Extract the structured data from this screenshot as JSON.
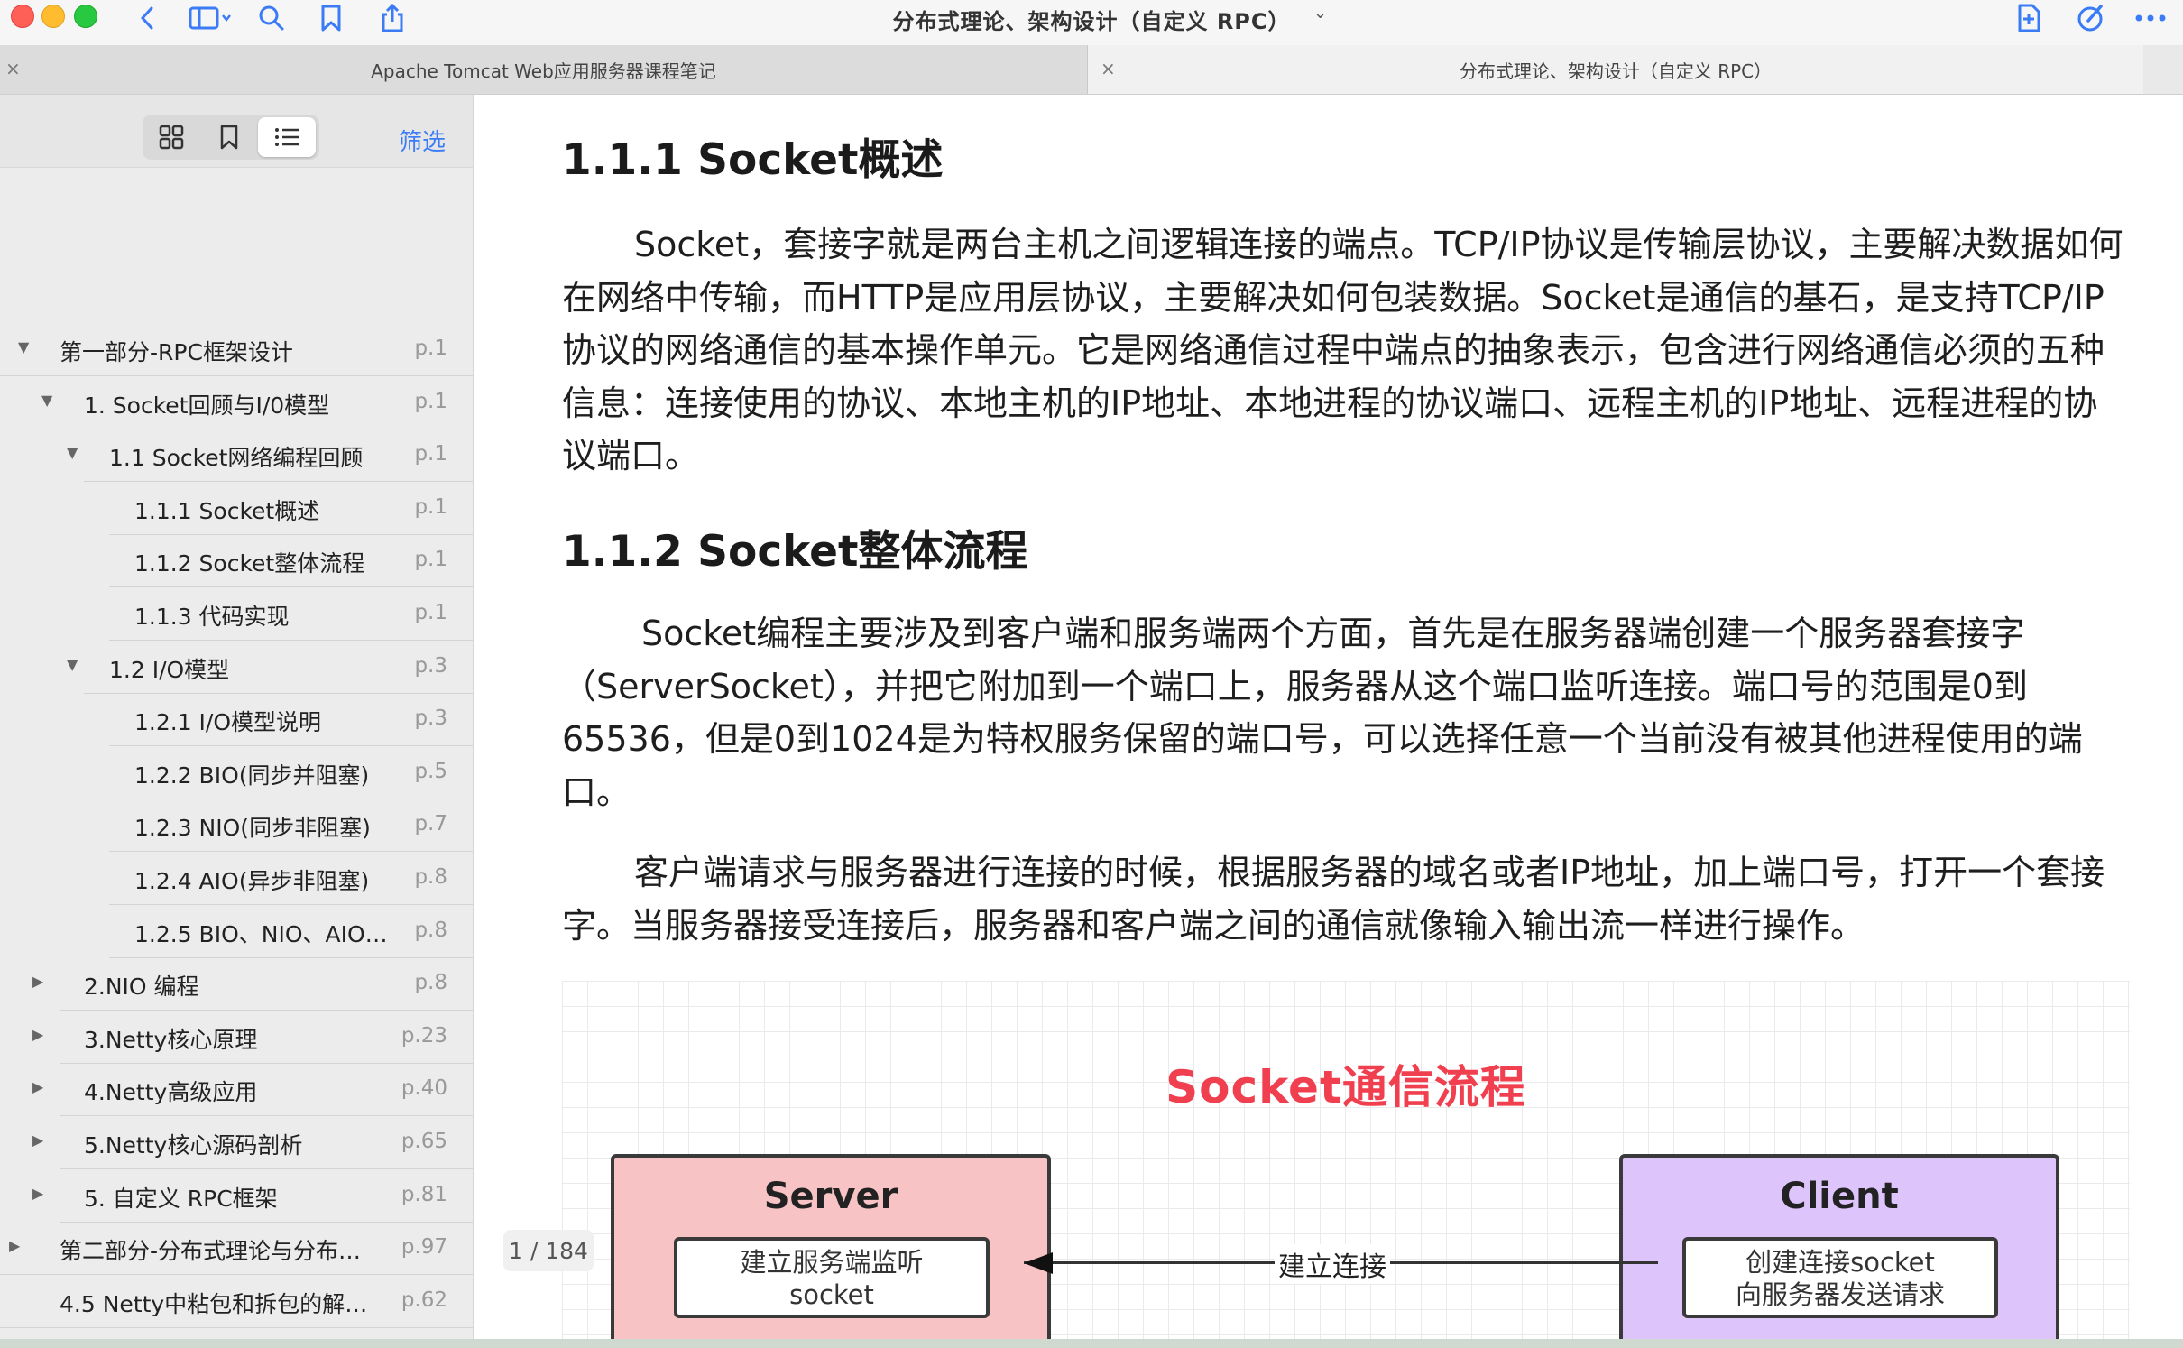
{
  "window": {
    "title": "分布式理论、架构设计（自定义 RPC）",
    "title_chevron": "⌄"
  },
  "toolbar": {
    "icons": [
      "back-icon",
      "sidebar-icon",
      "search-icon",
      "bookmark-icon",
      "share-icon",
      "add-page-icon",
      "markup-icon",
      "more-icon"
    ]
  },
  "tabs": [
    {
      "label": "Apache Tomcat Web应用服务器课程笔记",
      "close": "×"
    },
    {
      "label": "分布式理论、架构设计（自定义 RPC）",
      "close": "×"
    }
  ],
  "sidebar": {
    "filter_label": "筛选",
    "outline": [
      {
        "label": "第一部分-RPC框架设计",
        "page": "p.1",
        "arrow": "▼",
        "level": 0
      },
      {
        "label": "1. Socket回顾与I/0模型",
        "page": "p.1",
        "arrow": "▼",
        "level": 1
      },
      {
        "label": "1.1 Socket网络编程回顾",
        "page": "p.1",
        "arrow": "▼",
        "level": 2
      },
      {
        "label": "1.1.1 Socket概述",
        "page": "p.1",
        "arrow": "",
        "level": 3
      },
      {
        "label": "1.1.2 Socket整体流程",
        "page": "p.1",
        "arrow": "",
        "level": 3
      },
      {
        "label": "1.1.3 代码实现",
        "page": "p.1",
        "arrow": "",
        "level": 3
      },
      {
        "label": "1.2  I/O模型",
        "page": "p.3",
        "arrow": "▼",
        "level": 2
      },
      {
        "label": "1.2.1 I/O模型说明",
        "page": "p.3",
        "arrow": "",
        "level": 3
      },
      {
        "label": "1.2.2 BIO(同步并阻塞)",
        "page": "p.5",
        "arrow": "",
        "level": 3
      },
      {
        "label": "1.2.3 NIO(同步非阻塞)",
        "page": "p.7",
        "arrow": "",
        "level": 3
      },
      {
        "label": "1.2.4 AIO(异步非阻塞)",
        "page": "p.8",
        "arrow": "",
        "level": 3
      },
      {
        "label": "1.2.5 BIO、NIO、AIO 适…",
        "page": "p.8",
        "arrow": "",
        "level": 3
      },
      {
        "label": "2.NIO 编程",
        "page": "p.8",
        "arrow": "▶",
        "level": 1
      },
      {
        "label": "3.Netty核心原理",
        "page": "p.23",
        "arrow": "▶",
        "level": 1
      },
      {
        "label": "4.Netty高级应用",
        "page": "p.40",
        "arrow": "▶",
        "level": 1
      },
      {
        "label": "5.Netty核心源码剖析",
        "page": "p.65",
        "arrow": "▶",
        "level": 1
      },
      {
        "label": "5. 自定义 RPC框架",
        "page": "p.81",
        "arrow": "▶",
        "level": 1
      },
      {
        "label": "第二部分-分布式理论与分布…",
        "page": "p.97",
        "arrow": "▶",
        "level": 0
      },
      {
        "label": "4.5 Netty中粘包和拆包的解决…",
        "page": "p.62",
        "arrow": "",
        "level": 0
      }
    ]
  },
  "document": {
    "heading1": "1.1.1 Socket概述",
    "para1": "Socket，套接字就是两台主机之间逻辑连接的端点。TCP/IP协议是传输层协议，主要解决数据如何在网络中传输，而HTTP是应用层协议，主要解决如何包装数据。Socket是通信的基石，是支持TCP/IP协议的网络通信的基本操作单元。它是网络通信过程中端点的抽象表示，包含进行网络通信必须的五种信息：连接使用的协议、本地主机的IP地址、本地进程的协议端口、远程主机的IP地址、远程进程的协议端口。",
    "heading2": "1.1.2 Socket整体流程",
    "para2": "Socket编程主要涉及到客户端和服务端两个方面，首先是在服务器端创建一个服务器套接字（ServerSocket），并把它附加到一个端口上，服务器从这个端口监听连接。端口号的范围是0到65536，但是0到1024是为特权服务保留的端口号，可以选择任意一个当前没有被其他进程使用的端口。",
    "para3": "客户端请求与服务器进行连接的时候，根据服务器的域名或者IP地址，加上端口号，打开一个套接字。当服务器接受连接后，服务器和客户端之间的通信就像输入输出流一样进行操作。"
  },
  "figure": {
    "title": "Socket通信流程",
    "server_title": "Server",
    "server_line1": "建立服务端监听",
    "server_line2": "socket",
    "client_title": "Client",
    "client_line1": "创建连接socket",
    "client_line2": "向服务器发送请求",
    "connection_label": "建立连接",
    "colors": {
      "title": "#f0404f",
      "server_bg": "#f8c3c5",
      "client_bg": "#ddc4fb"
    }
  },
  "page_indicator": "1 / 184"
}
